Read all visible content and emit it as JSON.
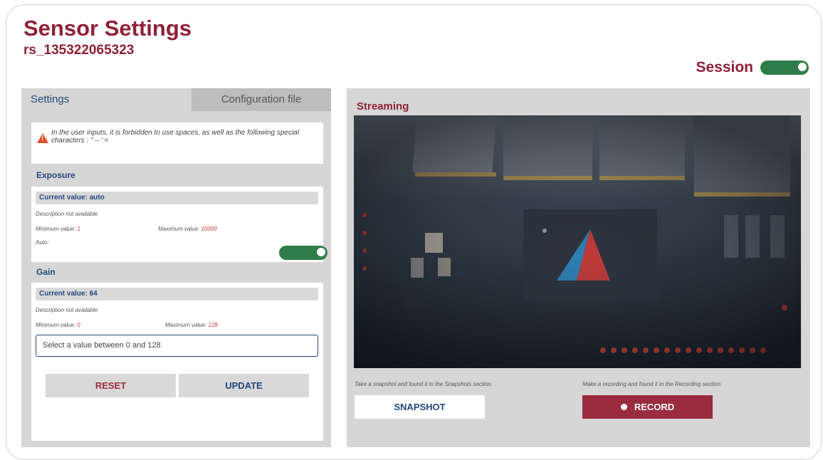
{
  "header": {
    "title": "Sensor Settings",
    "device_id": "rs_135322065323",
    "session_label": "Session",
    "session_on": true
  },
  "left": {
    "tabs": [
      "Settings",
      "Configuration file"
    ],
    "warning": "In the user inputs, it is forbidden to use spaces, as well as the following special characters : \" – ' =",
    "exposure": {
      "title": "Exposure",
      "current": "Current value: auto",
      "description": "Description not available",
      "min_label": "Minimum value:",
      "min": "1",
      "max_label": "Maximum value:",
      "max": "10000",
      "auto_label": "Auto:",
      "auto_on": true
    },
    "gain": {
      "title": "Gain",
      "current": "Current value: 64",
      "description": "Description not available",
      "min_label": "Minimum value:",
      "min": "0",
      "max_label": "Maximum value:",
      "max": "128",
      "placeholder": "Select a value between 0 and 128"
    },
    "reset_label": "RESET",
    "update_label": "UPDATE"
  },
  "right": {
    "title": "Streaming",
    "snapshot_hint": "Take a snapshot and found it in the Snapshots section.",
    "record_hint": "Make a recording and found it in the Recording section.",
    "snapshot_label": "SNAPSHOT",
    "record_label": "RECORD"
  },
  "colors": {
    "brand": "#8f2136",
    "accent_blue": "#22487a",
    "toggle_green": "#2e7d48",
    "panel_gray": "#d6d6d6"
  }
}
